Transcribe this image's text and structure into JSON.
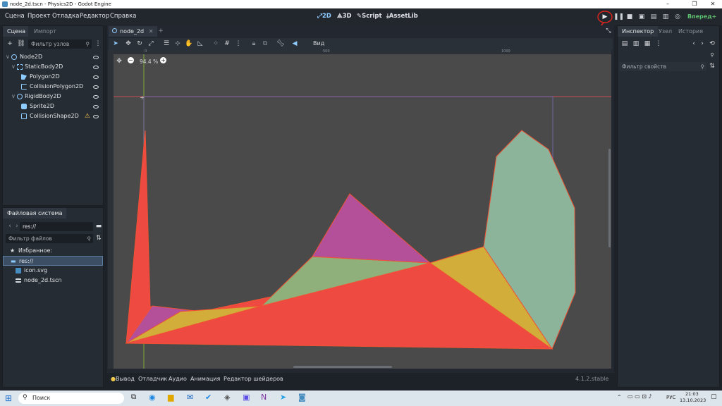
{
  "window": {
    "title": "node_2d.tscn - Physics2D - Godot Engine"
  },
  "menu": {
    "items": [
      "Сцена",
      "Проект",
      "Отладка",
      "Редактор",
      "Справка"
    ]
  },
  "modes": [
    {
      "label": "2D",
      "icon": "2d-icon"
    },
    {
      "label": "3D",
      "icon": "3d-icon"
    },
    {
      "label": "Script",
      "icon": "script-icon"
    },
    {
      "label": "AssetLib",
      "icon": "assetlib-icon"
    }
  ],
  "renderer": {
    "label": "Вперед+",
    "color": "#5fbf6f"
  },
  "scene_panel": {
    "tabs": [
      "Сцена",
      "Импорт"
    ],
    "filter_placeholder": "Фильтр узлов",
    "nodes": [
      {
        "name": "Node2D",
        "icon": "node2d-icon",
        "color": "#a5b7f3"
      },
      {
        "name": "StaticBody2D",
        "icon": "staticbody2d-icon",
        "color": "#a5b7f3"
      },
      {
        "name": "Polygon2D",
        "icon": "polygon2d-icon",
        "color": "#a5b7f3"
      },
      {
        "name": "CollisionPolygon2D",
        "icon": "collisionpolygon2d-icon",
        "color": "#a5b7f3"
      },
      {
        "name": "RigidBody2D",
        "icon": "rigidbody2d-icon",
        "color": "#a5b7f3"
      },
      {
        "name": "Sprite2D",
        "icon": "sprite2d-icon",
        "color": "#a5b7f3"
      },
      {
        "name": "CollisionShape2D",
        "icon": "collisionshape2d-icon",
        "color": "#a5b7f3",
        "warning": true
      }
    ]
  },
  "filesystem_panel": {
    "title": "Файловая система",
    "path": "res://",
    "filter_placeholder": "Фильтр файлов",
    "items": [
      {
        "label": "Избранное:",
        "icon": "star-icon"
      },
      {
        "label": "res://",
        "icon": "folder-icon"
      },
      {
        "label": "icon.svg",
        "icon": "image-file-icon"
      },
      {
        "label": "node_2d.tscn",
        "icon": "scene-file-icon"
      }
    ]
  },
  "editor_tabs": [
    {
      "label": "node_2d"
    }
  ],
  "viewport": {
    "zoom": "94.4 %",
    "view_menu": "Вид",
    "ruler_labels": [
      "0",
      "500",
      "1000"
    ],
    "polygon_colors": [
      "#ef4a42",
      "#b44f9a",
      "#8fb07a",
      "#d2ad3a",
      "#8bb49b",
      "#f05233"
    ]
  },
  "bottom_panel": {
    "tabs": [
      "Вывод",
      "Отладчик",
      "Аудио",
      "Анимация",
      "Редактор шейдеров"
    ],
    "version": "4.1.2.stable"
  },
  "inspector": {
    "tabs": [
      "Инспектор",
      "Узел",
      "История"
    ],
    "filter_placeholder": "Фильтр свойств"
  },
  "taskbar": {
    "search": "Поиск",
    "lang": "РУС",
    "time": "21:03",
    "date": "13.10.2023"
  }
}
